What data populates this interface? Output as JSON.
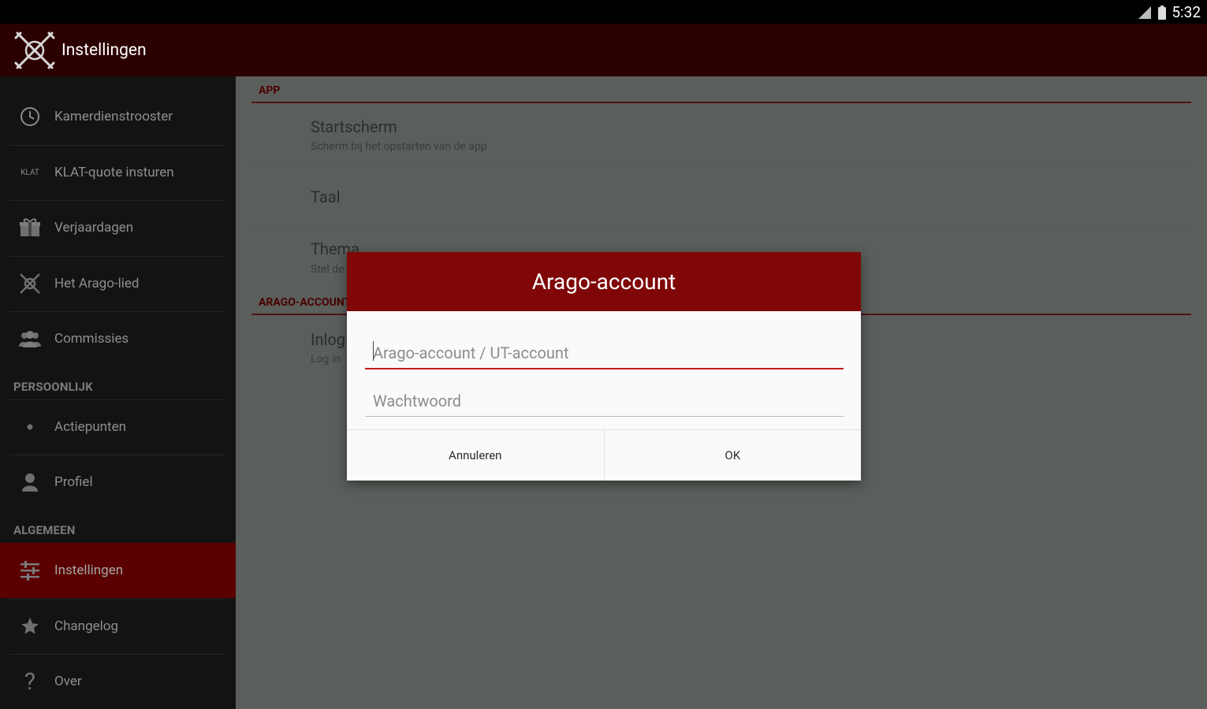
{
  "status_bar": {
    "time": "5:32"
  },
  "app_bar": {
    "title": "Instellingen",
    "logo_icon": "arago-logo-icon"
  },
  "drawer": {
    "items_top": [
      {
        "label": "Kamerdienstrooster",
        "icon": "clock-icon"
      },
      {
        "label": "KLAT-quote insturen",
        "icon": "klat-icon",
        "icon_text": "KLAT"
      },
      {
        "label": "Verjaardagen",
        "icon": "gift-icon"
      },
      {
        "label": "Het Arago-lied",
        "icon": "arago-logo-icon"
      },
      {
        "label": "Commissies",
        "icon": "group-icon"
      }
    ],
    "section_personal": "PERSOONLIJK",
    "items_personal": [
      {
        "label": "Actiepunten",
        "icon": "bullet-icon"
      },
      {
        "label": "Profiel",
        "icon": "person-icon"
      }
    ],
    "section_general": "ALGEMEEN",
    "items_general": [
      {
        "label": "Instellingen",
        "icon": "sliders-icon",
        "active": true
      },
      {
        "label": "Changelog",
        "icon": "star-icon"
      },
      {
        "label": "Over",
        "icon": "help-icon"
      }
    ]
  },
  "settings": {
    "section_app": "APP",
    "startscherm": {
      "title": "Startscherm",
      "summary": "Scherm bij het opstarten van de app"
    },
    "taal": {
      "title": "Taal"
    },
    "thema": {
      "title": "Thema",
      "summary": "Stel de"
    },
    "section_account": "ARAGO-ACCOUNT",
    "inloggen": {
      "title": "Inlog",
      "summary": "Log in"
    }
  },
  "dialog": {
    "title": "Arago-account",
    "username_placeholder": "Arago-account / UT-account",
    "password_placeholder": "Wachtwoord",
    "cancel_label": "Annuleren",
    "ok_label": "OK"
  },
  "colors": {
    "app_bar": "#2b0000",
    "dialog_header": "#7f0707",
    "accent": "#c21b1b",
    "drawer_bg": "#131313",
    "drawer_active": "#5a0000",
    "content_dim": "#5b5f5b"
  }
}
